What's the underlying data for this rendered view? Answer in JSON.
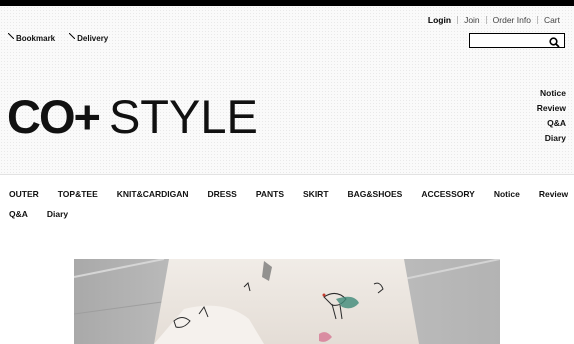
{
  "utility": {
    "login": "Login",
    "join": "Join",
    "order_info": "Order Info",
    "cart": "Cart"
  },
  "shortcuts": {
    "bookmark": "Bookmark",
    "delivery": "Delivery"
  },
  "search": {
    "value": "",
    "placeholder": ""
  },
  "logo": {
    "bold": "CO+",
    "light": "STYLE"
  },
  "side_links": [
    "Notice",
    "Review",
    "Q&A",
    "Diary"
  ],
  "nav": {
    "row1": [
      "OUTER",
      "TOP&TEE",
      "KNIT&CARDIGAN",
      "DRESS",
      "PANTS",
      "SKIRT",
      "BAG&SHOES",
      "ACCESSORY",
      "Notice",
      "Review"
    ],
    "row2": [
      "Q&A",
      "Diary"
    ]
  },
  "colors": {
    "top_bar": "#000000",
    "accent_green": "#2f7d6b"
  }
}
